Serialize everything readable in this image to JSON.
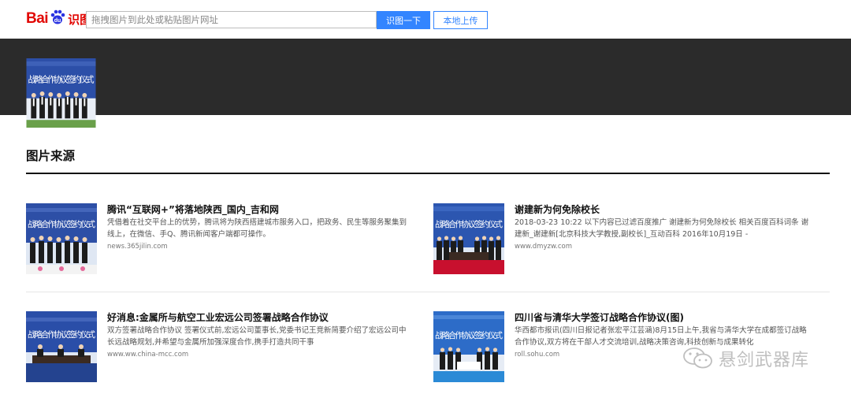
{
  "header": {
    "logo_bai": "Bai",
    "logo_du": "du",
    "logo_shitu": "识图",
    "search_placeholder": "拖拽图片到此处或粘贴图片网址",
    "shitu_button": "识图一下",
    "upload_button": "本地上传"
  },
  "thumbnail_sign_text": "战略合作协议签约仪式",
  "section": {
    "title": "图片来源"
  },
  "results": [
    {
      "title": "腾讯“互联网+”将落地陕西_国内_吉和网",
      "desc": "凭借着在社交平台上的优势，腾讯将为陕西搭建城市服务入口，把政务、民生等服务聚集到线上，在微信、手Q、腾讯新闻客户端都可操作。",
      "source": "news.365jilin.com"
    },
    {
      "title": "谢建新为何免除校长",
      "desc": "2018-03-23 10:22 以下内容已过滤百度推广 谢建新为何免除校长 相关百度百科词条 谢建新_谢建新[北京科技大学教授,副校长]_互动百科 2016年10月19日 -",
      "source": "www.dmyzw.com"
    },
    {
      "title": "好消息:金属所与航空工业宏远公司签署战略合作协议",
      "desc": "双方签署战略合作协议 签署仪式前,宏远公司董事长,党委书记王竞新简要介绍了宏远公司中长远战略规划,并希望与金属所加强深度合作,携手打造共同干事",
      "source": "www.ww.china-mcc.com"
    },
    {
      "title": "四川省与清华大学签订战略合作协议(图)",
      "desc": "华西都市报讯(四川日报记者张宏平江芸涵)8月15日上午,我省与清华大学在成都签订战略合作协议,双方将在干部人才交流培训,战略决策咨询,科技创新与成果转化",
      "source": "roll.sohu.com"
    }
  ],
  "watermark": {
    "text": "悬剑武器库"
  },
  "colors": {
    "brand_red": "#e10602",
    "accent_blue": "#3385ff",
    "banner": "#2b2b2b"
  }
}
